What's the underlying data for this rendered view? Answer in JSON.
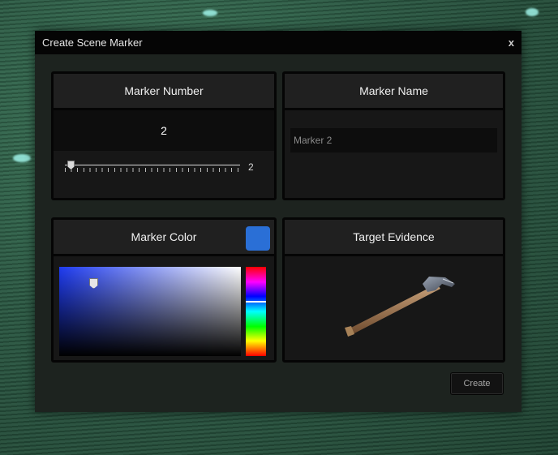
{
  "dialog": {
    "title": "Create Scene Marker",
    "close_label": "x"
  },
  "marker_number": {
    "header": "Marker Number",
    "value": "2",
    "slider_value": "2"
  },
  "marker_name": {
    "header": "Marker Name",
    "input_value": "Marker 2"
  },
  "marker_color": {
    "header": "Marker Color",
    "swatch_color": "#2a6fd6"
  },
  "target_evidence": {
    "header": "Target Evidence",
    "item_icon": "axe-icon"
  },
  "actions": {
    "create_label": "Create"
  }
}
